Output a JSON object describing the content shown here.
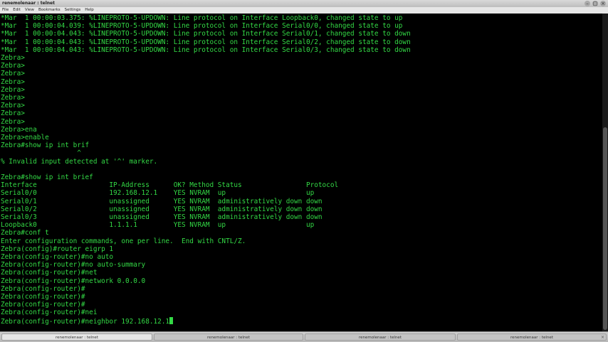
{
  "window": {
    "title": "renemolenaar : telnet"
  },
  "menu": [
    "File",
    "Edit",
    "View",
    "Bookmarks",
    "Settings",
    "Help"
  ],
  "terminal": {
    "lines": [
      "*Mar  1 00:00:03.375: %LINEPROTO-5-UPDOWN: Line protocol on Interface Loopback0, changed state to up",
      "*Mar  1 00:00:04.039: %LINEPROTO-5-UPDOWN: Line protocol on Interface Serial0/0, changed state to up",
      "*Mar  1 00:00:04.043: %LINEPROTO-5-UPDOWN: Line protocol on Interface Serial0/1, changed state to down",
      "*Mar  1 00:00:04.043: %LINEPROTO-5-UPDOWN: Line protocol on Interface Serial0/2, changed state to down",
      "*Mar  1 00:00:04.043: %LINEPROTO-5-UPDOWN: Line protocol on Interface Serial0/3, changed state to down",
      "Zebra>",
      "Zebra>",
      "Zebra>",
      "Zebra>",
      "Zebra>",
      "Zebra>",
      "Zebra>",
      "Zebra>",
      "Zebra>",
      "Zebra>ena",
      "Zebra>enable",
      "Zebra#show ip int brif",
      "                   ^",
      "% Invalid input detected at '^' marker.",
      "",
      "Zebra#show ip int brief",
      "Interface                  IP-Address      OK? Method Status                Protocol",
      "Serial0/0                  192.168.12.1    YES NVRAM  up                    up",
      "Serial0/1                  unassigned      YES NVRAM  administratively down down",
      "Serial0/2                  unassigned      YES NVRAM  administratively down down",
      "Serial0/3                  unassigned      YES NVRAM  administratively down down",
      "Loopback0                  1.1.1.1         YES NVRAM  up                    up",
      "Zebra#conf t",
      "Enter configuration commands, one per line.  End with CNTL/Z.",
      "Zebra(config)#router eigrp 1",
      "Zebra(config-router)#no auto",
      "Zebra(config-router)#no auto-summary",
      "Zebra(config-router)#net",
      "Zebra(config-router)#network 0.0.0.0",
      "Zebra(config-router)#",
      "Zebra(config-router)#",
      "Zebra(config-router)#",
      "Zebra(config-router)#nei",
      "Zebra(config-router)#neighbor 192.168.12.1"
    ]
  },
  "tabs": [
    {
      "label": "renemolenaar : telnet",
      "active": true
    },
    {
      "label": "renemolenaar : telnet",
      "active": false
    },
    {
      "label": "renemolenaar : telnet",
      "active": false
    },
    {
      "label": "renemolenaar : telnet",
      "active": false
    }
  ]
}
